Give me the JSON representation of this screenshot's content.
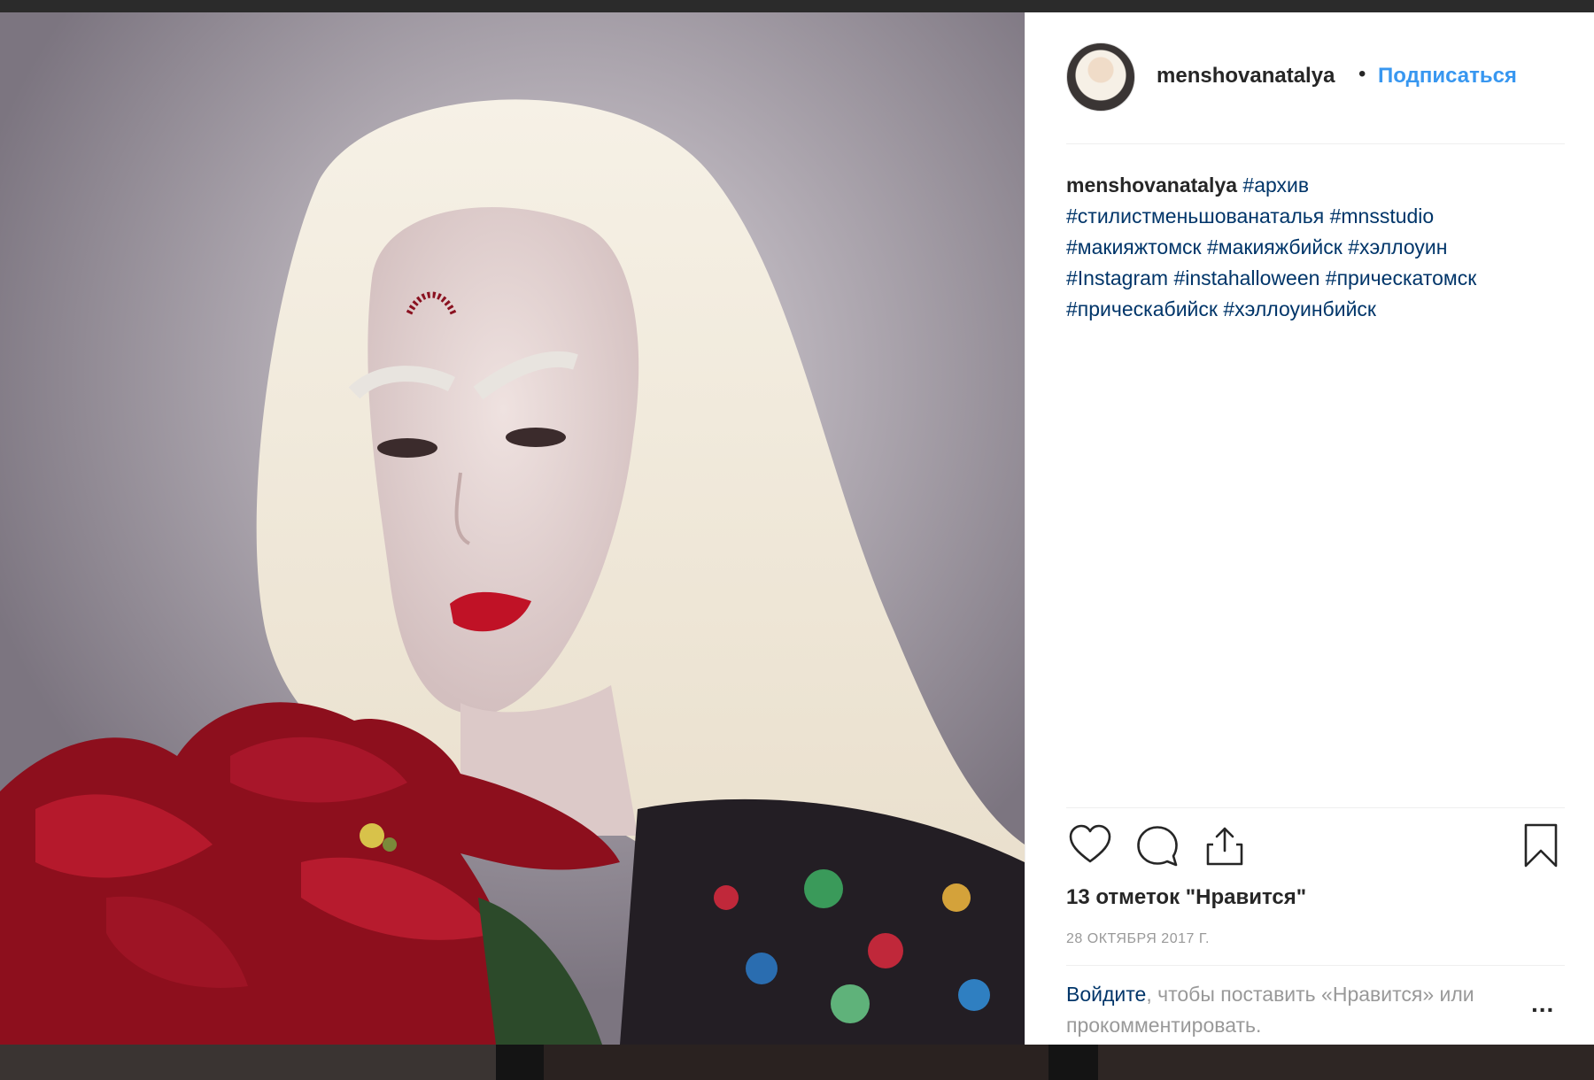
{
  "post": {
    "username": "menshovanatalya",
    "separator": "•",
    "follow_label": "Подписаться",
    "caption": {
      "username": "menshovanatalya",
      "hashtags": [
        "#архив",
        "#стилистменьшованаталья",
        "#mnsstudio",
        "#макияжтомск",
        "#макияжбийск",
        "#хэллоуин",
        "#Instagram",
        "#instahalloween",
        "#прическатомск",
        "#прическабийск",
        "#хэллоуинбийск"
      ]
    },
    "likes_text": "13 отметок \"Нравится\"",
    "date": "28 ОКТЯБРЯ 2017 Г.",
    "login_link": "Войдите",
    "login_rest": ", чтобы поставить «Нравится» или прокомментировать.",
    "more_label": "...",
    "icons": [
      "heart-icon",
      "comment-icon",
      "share-icon",
      "bookmark-icon"
    ],
    "colors": {
      "link": "#3897f0",
      "hashtag": "#003569",
      "muted": "#999999",
      "text": "#262626"
    }
  }
}
